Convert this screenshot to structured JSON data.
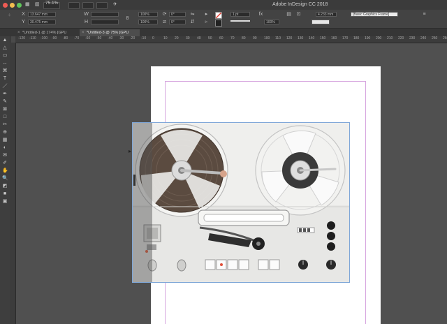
{
  "app": {
    "window_title": "Adobe InDesign CC 2018",
    "zoom": "75.1%"
  },
  "control_panel": {
    "x_value": "13.647 mm",
    "y_value": "30.475 mm",
    "w_value": "",
    "h_value": "",
    "stroke_weight": "1 pt",
    "scale_x": "100%",
    "scale_y": "100%",
    "rotate_value": "0°",
    "shear_value": "0°",
    "fit_value": "4.233 mm",
    "object_style": "[Basic Graphics Frame]"
  },
  "tabs": [
    {
      "label": "*Untitled-1 @ 174% [GPU Preview]",
      "active": false
    },
    {
      "label": "*Untitled-3 @ 75% [GPU Preview]",
      "active": true
    }
  ],
  "ruler": {
    "h_ticks": [
      "-120",
      "-110",
      "-100",
      "-90",
      "-80",
      "-70",
      "-60",
      "-50",
      "-40",
      "-30",
      "-20",
      "-10",
      "0",
      "10",
      "20",
      "30",
      "40",
      "50",
      "60",
      "70",
      "80",
      "90",
      "100",
      "110",
      "120",
      "130",
      "140",
      "150",
      "160",
      "170",
      "180",
      "190",
      "200",
      "210",
      "220",
      "230",
      "240",
      "250",
      "260"
    ]
  },
  "tools": [
    "select-icon",
    "direct-select-icon",
    "page-tool-icon",
    "gap-tool-icon",
    "content-collector-icon",
    "type-tool-icon",
    "line-tool-icon",
    "pen-tool-icon",
    "pencil-tool-icon",
    "rect-frame-icon",
    "rect-tool-icon",
    "scissors-icon",
    "free-transform-icon",
    "gradient-swatch-icon",
    "gradient-feather-icon",
    "note-icon",
    "eyedropper-icon",
    "hand-icon",
    "zoom-icon",
    "fill-stroke-icon",
    "apply-color-icon",
    "view-mode-icon"
  ],
  "reel_labels": [
    "",
    "",
    "",
    "",
    "",
    "",
    "",
    ""
  ],
  "colors": {
    "accent": "#7fa7d8",
    "margin_guide": "#d7a6df",
    "stroke_swatch": "#e33a2f"
  }
}
